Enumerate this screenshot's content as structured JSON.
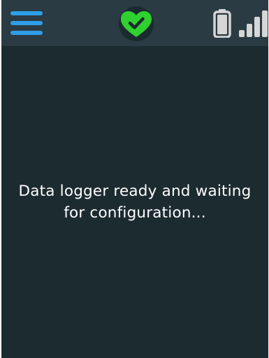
{
  "status_bar": {
    "menu_icon": "hamburger-menu-icon",
    "health_icon": "heart-check-icon",
    "battery_icon": "battery-icon",
    "signal_icon": "signal-bars-icon",
    "colors": {
      "menu": "#2e9ee8",
      "health": "#2fd12f",
      "battery": "#d6d6d6",
      "signal": "#d6d6d6"
    }
  },
  "main": {
    "message_line1": "Data logger ready and waiting",
    "message_line2": "for configuration..."
  },
  "colors": {
    "screen_background": "#1c2b30",
    "status_bar_background": "#2a3b43",
    "text": "#ffffff"
  }
}
